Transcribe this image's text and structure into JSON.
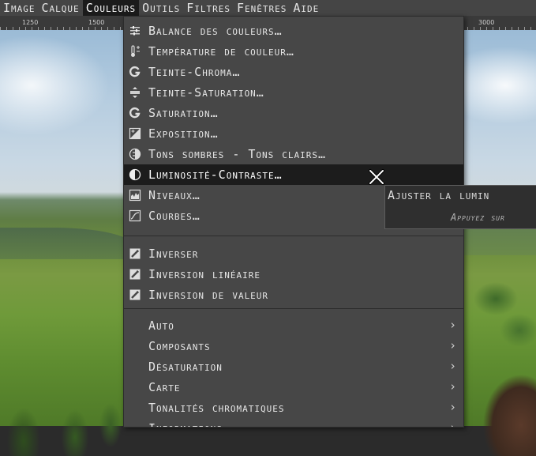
{
  "menubar": {
    "items": [
      {
        "label": "Image"
      },
      {
        "label": "Calque"
      },
      {
        "label": "Couleurs",
        "active": true
      },
      {
        "label": "Outils"
      },
      {
        "label": "Filtres"
      },
      {
        "label": "Fenêtres"
      },
      {
        "label": "Aide"
      }
    ]
  },
  "ruler": {
    "labels": [
      "1250",
      "1500",
      "3000"
    ]
  },
  "colors_menu": {
    "items": [
      {
        "label": "Balance des couleurs…",
        "icon": "color-balance-icon"
      },
      {
        "label": "Température de couleur…",
        "icon": "thermometer-icon"
      },
      {
        "label": "Teinte-Chroma…",
        "icon": "gegl-icon"
      },
      {
        "label": "Teinte-Saturation…",
        "icon": "hue-saturation-icon"
      },
      {
        "label": "Saturation…",
        "icon": "gegl-icon"
      },
      {
        "label": "Exposition…",
        "icon": "exposure-icon"
      },
      {
        "label": "Tons sombres - Tons clairs…",
        "icon": "shadows-highlights-icon"
      },
      {
        "label": "Luminosité-Contraste…",
        "icon": "brightness-contrast-icon",
        "highlighted": true
      },
      {
        "label": "Niveaux…",
        "icon": "levels-icon"
      },
      {
        "label": "Courbes…",
        "icon": "curves-icon"
      },
      {
        "label": "Inverser",
        "icon": "invert-icon"
      },
      {
        "label": "Inversion linéaire",
        "icon": "invert-icon"
      },
      {
        "label": "Inversion de valeur",
        "icon": "invert-icon"
      },
      {
        "label": "Auto",
        "submenu": true
      },
      {
        "label": "Composants",
        "submenu": true
      },
      {
        "label": "Désaturation",
        "submenu": true
      },
      {
        "label": "Carte",
        "submenu": true
      },
      {
        "label": "Tonalités chromatiques",
        "submenu": true
      },
      {
        "label": "Informations",
        "submenu": true
      }
    ],
    "submenu_arrow": "›"
  },
  "tooltip": {
    "title": "Ajuster la lumin",
    "hint": "Appuyez sur"
  },
  "colors": {
    "menubar_bg": "#454545",
    "menu_bg": "#474747",
    "highlight_bg": "#1c1c1c",
    "text": "#e6e6e6"
  }
}
